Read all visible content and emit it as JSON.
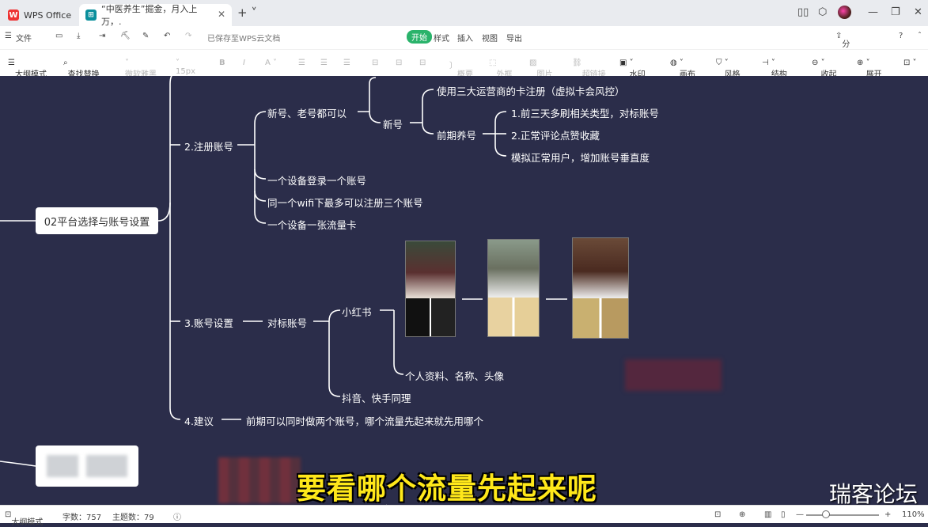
{
  "tabs": [
    {
      "label": "WPS Office"
    },
    {
      "label": "“中医养生”掘金，月入上万，."
    }
  ],
  "menubar": {
    "file": "文件",
    "saved": "已保存至WPS云文档",
    "items": [
      "开始",
      "样式",
      "插入",
      "视图",
      "导出"
    ],
    "share": "分享与协作"
  },
  "toolbar": {
    "outline_mode": "大纲模式",
    "find_replace": "查找替换",
    "font": "微软雅黑",
    "size": "15px",
    "summary": "概要",
    "frame": "外框",
    "image": "图片",
    "link": "超链接",
    "watermark": "水印",
    "canvas": "画布",
    "style": "风格",
    "structure": "结构",
    "collapse": "收起",
    "expand": "展开"
  },
  "mindmap": {
    "root": "02平台选择与账号设置",
    "register": "2.注册账号",
    "old_new": "新号、老号都可以",
    "new_acc": "新号",
    "sim_card": "使用三大运营商的卡注册（虚拟卡会风控）",
    "nurture": "前期养号",
    "nurture_1": "1.前三天多刷相关类型，对标账号",
    "nurture_2": "2.正常评论点赞收藏",
    "nurture_3": "模拟正常用户，增加账号垂直度",
    "one_device": "一个设备登录一个账号",
    "wifi": "同一个wifi下最多可以注册三个账号",
    "sim_one": "一个设备一张流量卡",
    "account_settings": "3.账号设置",
    "benchmark": "对标账号",
    "xhs": "小红书",
    "profile": "个人资料、名称、头像",
    "douyin": "抖音、快手同理",
    "advice": "4.建议",
    "advice_text": "前期可以同时做两个账号，哪个流量先起来就先用哪个"
  },
  "subtitle": "要看哪个流量先起来呢",
  "watermark": "瑞客论坛",
  "status": {
    "outline": "大纲模式",
    "word_count": "字数：757",
    "topic_count": "主题数：79",
    "zoom": "110%"
  },
  "colors": {
    "canvas_bg": "#2b2d4a",
    "line": "#ffffff",
    "accent_green": "#2ab36b",
    "subtitle_yellow": "#ffe81a"
  }
}
